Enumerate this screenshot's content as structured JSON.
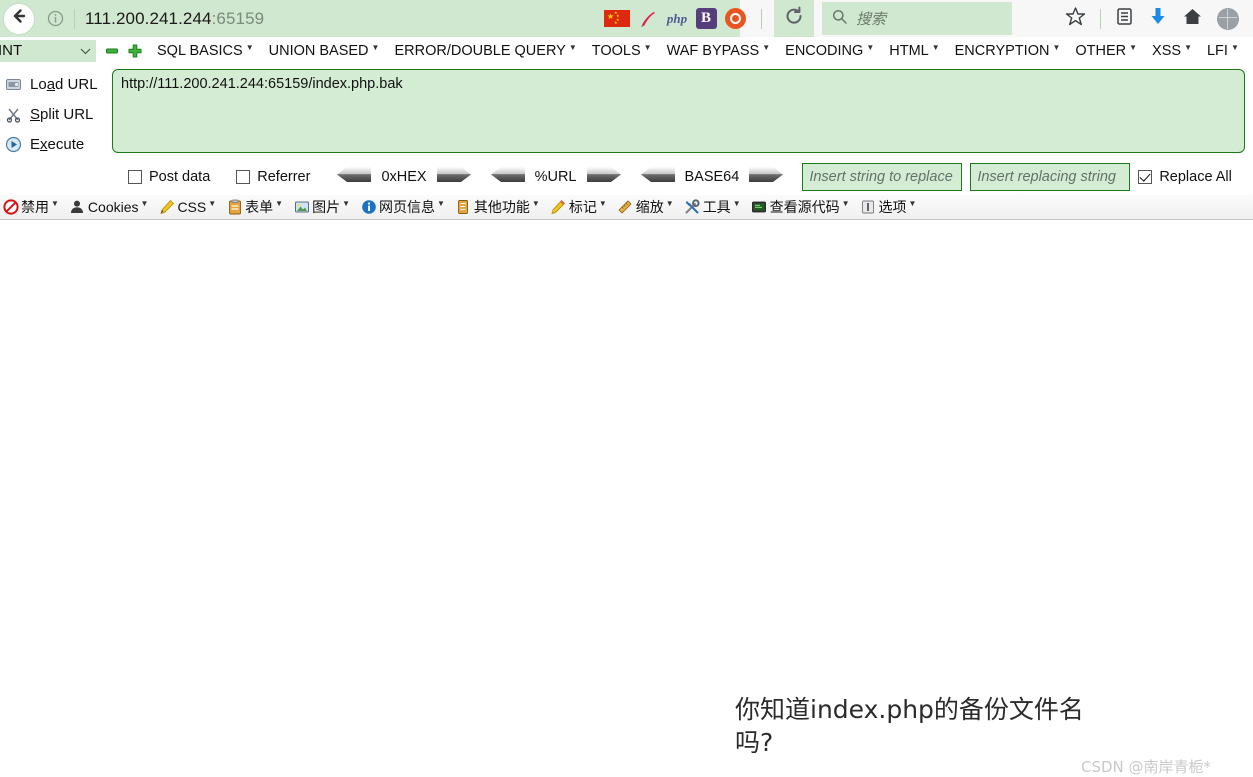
{
  "browser": {
    "back_icon": "back-arrow-icon",
    "info_icon": "page-info-icon",
    "url_host": "111.200.241.244",
    "url_port": ":65159",
    "extension_icons": [
      "china-flag-icon",
      "apache-feather-icon",
      "php-logo-icon",
      "bootstrap-logo-icon",
      "ubuntu-logo-icon"
    ],
    "php_label": "php",
    "bootstrap_label": "B",
    "reload_icon": "reload-icon",
    "noscript_icon": "noscript-blocked-icon",
    "search": {
      "icon": "search-icon",
      "placeholder": "搜索",
      "value": ""
    },
    "right_icons": [
      "bookmark-star-icon",
      "library-icon",
      "downloads-icon",
      "home-icon",
      "account-globe-icon"
    ]
  },
  "hackbar": {
    "select_value": "INT",
    "minus_label": "remove-tab-icon",
    "plus_label": "add-tab-icon",
    "menus": [
      {
        "label": "SQL BASICS"
      },
      {
        "label": "UNION BASED"
      },
      {
        "label": "ERROR/DOUBLE QUERY"
      },
      {
        "label": "TOOLS"
      },
      {
        "label": "WAF BYPASS"
      },
      {
        "label": "ENCODING"
      },
      {
        "label": "HTML"
      },
      {
        "label": "ENCRYPTION"
      },
      {
        "label": "OTHER"
      },
      {
        "label": "XSS"
      },
      {
        "label": "LFI"
      }
    ],
    "actions": [
      {
        "label_pre": "Lo",
        "label_key": "a",
        "label_post": "d URL",
        "icon": "load-url-icon"
      },
      {
        "label_pre": "",
        "label_key": "S",
        "label_post": "plit URL",
        "icon": "split-url-icon"
      },
      {
        "label_pre": "E",
        "label_key": "x",
        "label_post": "ecute",
        "icon": "execute-icon"
      }
    ],
    "url_value": "http://111.200.241.244:65159/index.php.bak",
    "post_data_label": "Post data",
    "post_data_checked": false,
    "referrer_label": "Referrer",
    "referrer_checked": false,
    "converters": [
      {
        "label": "0xHEX"
      },
      {
        "label": "%URL"
      },
      {
        "label": "BASE64"
      }
    ],
    "replace_from_placeholder": "Insert string to replace",
    "replace_from_value": "",
    "replace_to_placeholder": "Insert replacing string",
    "replace_to_value": "",
    "replace_all_label": "Replace All",
    "replace_all_checked": true
  },
  "webdev": {
    "items": [
      {
        "label": "禁用",
        "icon": "disable-icon"
      },
      {
        "label": "Cookies",
        "icon": "cookies-person-icon"
      },
      {
        "label": "CSS",
        "icon": "css-pencil-icon"
      },
      {
        "label": "表单",
        "icon": "forms-clipboard-icon"
      },
      {
        "label": "图片",
        "icon": "images-picture-icon"
      },
      {
        "label": "网页信息",
        "icon": "information-info-icon"
      },
      {
        "label": "其他功能",
        "icon": "miscellaneous-icon"
      },
      {
        "label": "标记",
        "icon": "outline-pencil-icon"
      },
      {
        "label": "缩放",
        "icon": "resize-ruler-icon"
      },
      {
        "label": "工具",
        "icon": "tools-wrench-icon"
      },
      {
        "label": "查看源代码",
        "icon": "view-source-icon"
      },
      {
        "label": "选项",
        "icon": "options-icon"
      }
    ]
  },
  "page": {
    "message": "你知道index.php的备份文件名吗?",
    "watermark": "CSDN @南岸青栀*"
  }
}
